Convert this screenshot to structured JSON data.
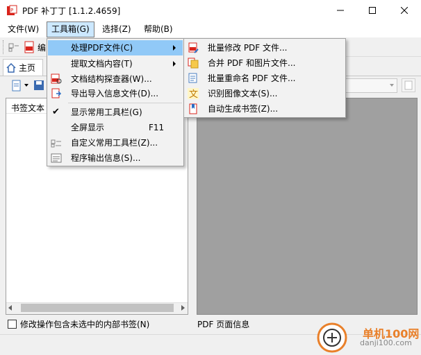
{
  "window": {
    "title": "PDF 补丁丁 [1.1.2.4659]"
  },
  "menubar": {
    "file": "文件(W)",
    "tools": "工具箱(G)",
    "select": "选择(Z)",
    "help": "帮助(B)"
  },
  "toolbar": {
    "edit_label": "编"
  },
  "tabs": {
    "home": "主页"
  },
  "left_panel": {
    "column_header": "书签文本",
    "checkbox_label": "修改操作包含未选中的内部书签(N)",
    "checkbox_checked": false
  },
  "right_panel": {
    "page_info": "PDF 页面信息"
  },
  "tools_menu": {
    "items": [
      {
        "label": "处理PDF文件(C)",
        "icon": "folder-icon",
        "submenu": true,
        "highlighted": true
      },
      {
        "label": "提取文档内容(T)",
        "icon": "",
        "submenu": true
      },
      {
        "label": "文档结构探查器(W)...",
        "icon": "pdf-inspect-icon"
      },
      {
        "label": "导出导入信息文件(D)...",
        "icon": "export-icon"
      },
      {
        "label": "显示常用工具栏(G)",
        "icon": "check-icon",
        "checked": true
      },
      {
        "label": "全屏显示",
        "shortcut": "F11",
        "icon": ""
      },
      {
        "label": "自定义常用工具栏(Z)...",
        "icon": "customize-icon"
      },
      {
        "label": "程序输出信息(S)...",
        "icon": "log-icon"
      }
    ]
  },
  "submenu": {
    "items": [
      {
        "label": "批量修改 PDF 文件...",
        "icon": "pdf-edit-icon"
      },
      {
        "label": "合并 PDF 和图片文件...",
        "icon": "pdf-merge-icon"
      },
      {
        "label": "批量重命名 PDF 文件...",
        "icon": "pdf-rename-icon"
      },
      {
        "label": "识别图像文本(S)...",
        "icon": "ocr-icon"
      },
      {
        "label": "自动生成书签(Z)...",
        "icon": "bookmark-icon"
      }
    ]
  },
  "watermark": {
    "site_name": "单机100网",
    "site_url": "danji100.com"
  },
  "colors": {
    "menu_highlight": "#91c9f7",
    "menubar_active": "#cce8ff",
    "preview_bg": "#a0a0a0",
    "pdf_red": "#d9241c"
  }
}
